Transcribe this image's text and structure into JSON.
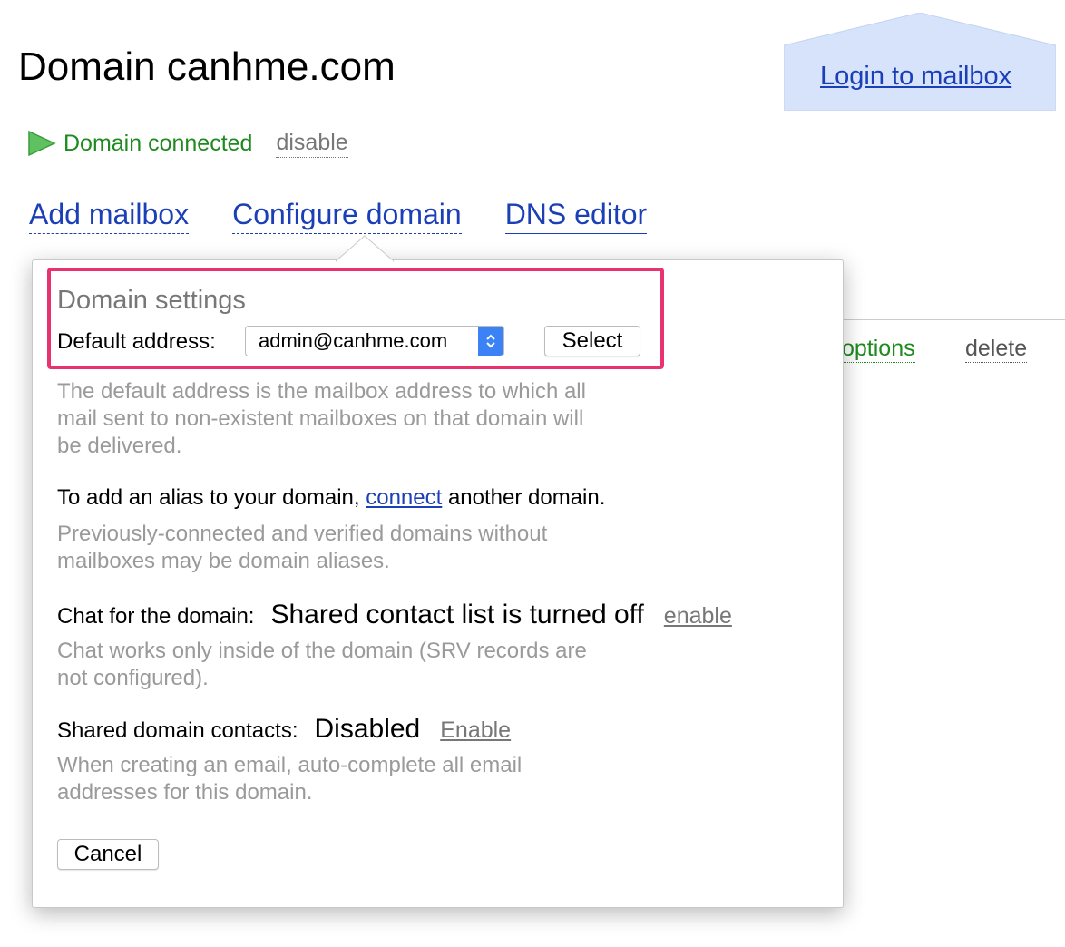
{
  "header": {
    "title": "Domain canhme.com",
    "login_label": "Login to mailbox"
  },
  "status": {
    "text": "Domain connected",
    "disable_label": "disable"
  },
  "nav": {
    "add_mailbox": "Add mailbox",
    "configure_domain": "Configure domain",
    "dns_editor": "DNS editor"
  },
  "background_row": {
    "options_label": "options",
    "delete_label": "delete"
  },
  "popup": {
    "section_title": "Domain settings",
    "default_address_label": "Default address:",
    "default_address_value": "admin@canhme.com",
    "select_button": "Select",
    "default_help_1": "The default address is the mailbox address to which all",
    "default_help_2": "mail sent to non-existent mailboxes on that domain will",
    "default_help_3": "be delivered.",
    "alias_prefix": "To add an alias to your domain,",
    "alias_link": "connect",
    "alias_suffix": "another domain.",
    "alias_help_1": "Previously-connected and verified domains without",
    "alias_help_2": "mailboxes may be domain aliases.",
    "chat_label": "Chat for the domain:",
    "chat_status": "Shared contact list is turned off",
    "chat_action": "enable",
    "chat_help_1": "Chat works only inside of the domain (SRV records are",
    "chat_help_2": "not configured).",
    "contacts_label": "Shared domain contacts:",
    "contacts_status": "Disabled",
    "contacts_action": "Enable",
    "contacts_help_1": "When creating an email, auto-complete all email",
    "contacts_help_2": "addresses for this domain.",
    "cancel_button": "Cancel"
  },
  "colors": {
    "link_blue": "#1a3fb7",
    "status_green": "#1f8a1f",
    "highlight_pink": "#e8336f",
    "help_gray": "#9a9a9a"
  },
  "icons": [
    "play-icon",
    "select-arrows-icon"
  ]
}
